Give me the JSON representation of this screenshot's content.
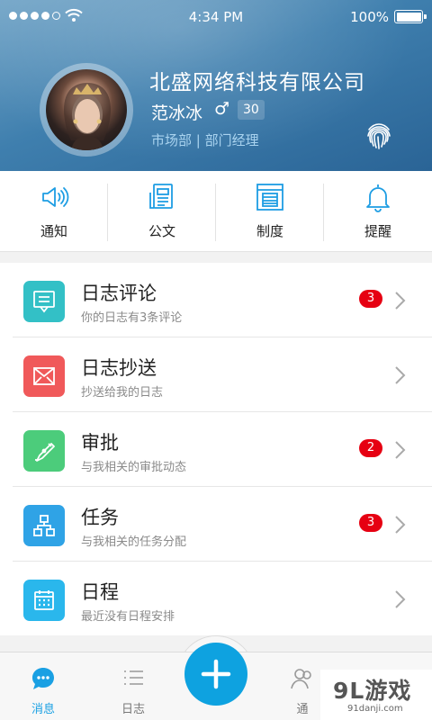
{
  "status_bar": {
    "time": "4:34 PM",
    "battery": "100%"
  },
  "profile": {
    "company": "北盛网络科技有限公司",
    "name": "范冰冰",
    "gender_symbol": "♂",
    "age": "30",
    "department": "市场部 | 部门经理",
    "avatar_icon": "user-avatar-photo",
    "fingerprint_icon": "fingerprint-icon"
  },
  "quick_actions": [
    {
      "label": "通知",
      "icon": "speaker-icon"
    },
    {
      "label": "公文",
      "icon": "document-icon"
    },
    {
      "label": "制度",
      "icon": "rules-icon"
    },
    {
      "label": "提醒",
      "icon": "bell-icon"
    }
  ],
  "list": [
    {
      "title": "日志评论",
      "subtitle": "你的日志有3条评论",
      "badge": "3",
      "icon": "comment-icon",
      "color": "#33c0c6"
    },
    {
      "title": "日志抄送",
      "subtitle": "抄送给我的日志",
      "badge": "",
      "icon": "mail-icon",
      "color": "#f0595a"
    },
    {
      "title": "审批",
      "subtitle": "与我相关的审批动态",
      "badge": "2",
      "icon": "pen-icon",
      "color": "#4ccc7b"
    },
    {
      "title": "任务",
      "subtitle": "与我相关的任务分配",
      "badge": "3",
      "icon": "org-chart-icon",
      "color": "#2fa3e6"
    },
    {
      "title": "日程",
      "subtitle": "最近没有日程安排",
      "badge": "",
      "icon": "calendar-icon",
      "color": "#2ab7ec"
    }
  ],
  "tabbar": {
    "tabs": [
      {
        "label": "消息",
        "icon": "chat-icon",
        "active": true
      },
      {
        "label": "日志",
        "icon": "list-icon",
        "active": false
      },
      {
        "label": "通",
        "icon": "contacts-icon",
        "active": false
      }
    ],
    "add_icon": "plus-icon"
  },
  "watermark": {
    "brand": "9L游戏",
    "url": "91danji.com"
  },
  "colors": {
    "accent": "#0ea2e0",
    "badge": "#e60012",
    "header_top": "#74a6c8",
    "header_bottom": "#2a6496"
  }
}
